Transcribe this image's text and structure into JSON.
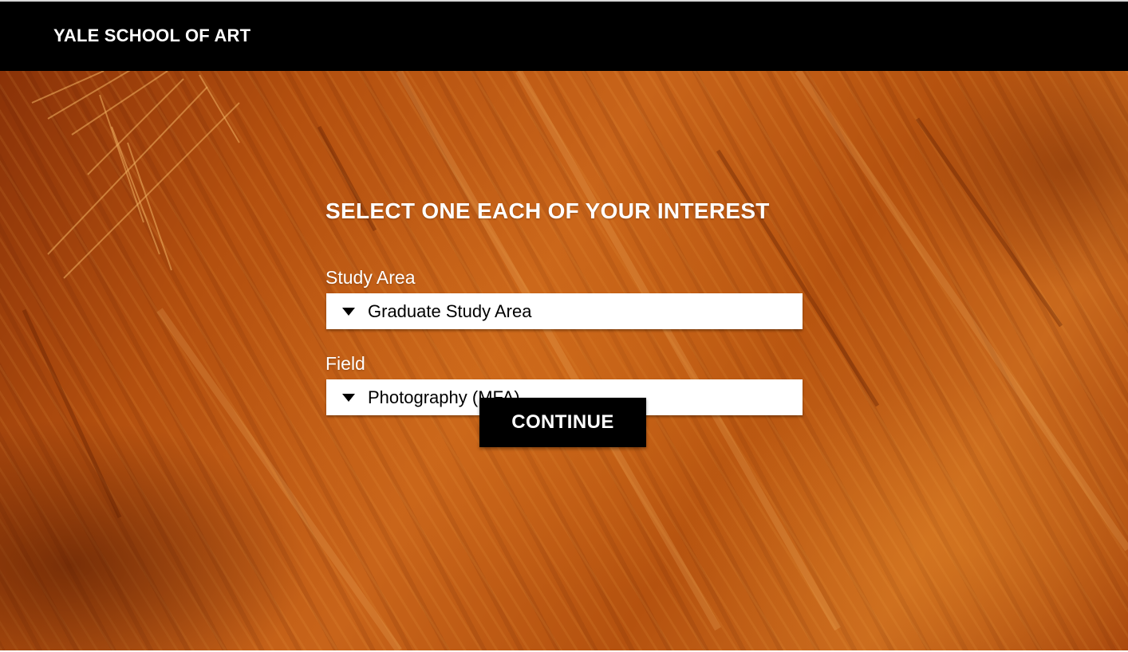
{
  "header": {
    "brand": "YALE SCHOOL OF ART"
  },
  "form": {
    "heading": "SELECT ONE EACH OF YOUR INTEREST",
    "study_area": {
      "label": "Study Area",
      "value": "Graduate Study Area",
      "icon": "caret-down-icon"
    },
    "field": {
      "label": "Field",
      "value": "Photography (MFA)",
      "icon": "caret-down-icon"
    },
    "continue_label": "CONTINUE"
  },
  "colors": {
    "header_bg": "#000000",
    "background_paint": "#c0601a",
    "button_bg": "#000000",
    "text_light": "#ffffff"
  }
}
